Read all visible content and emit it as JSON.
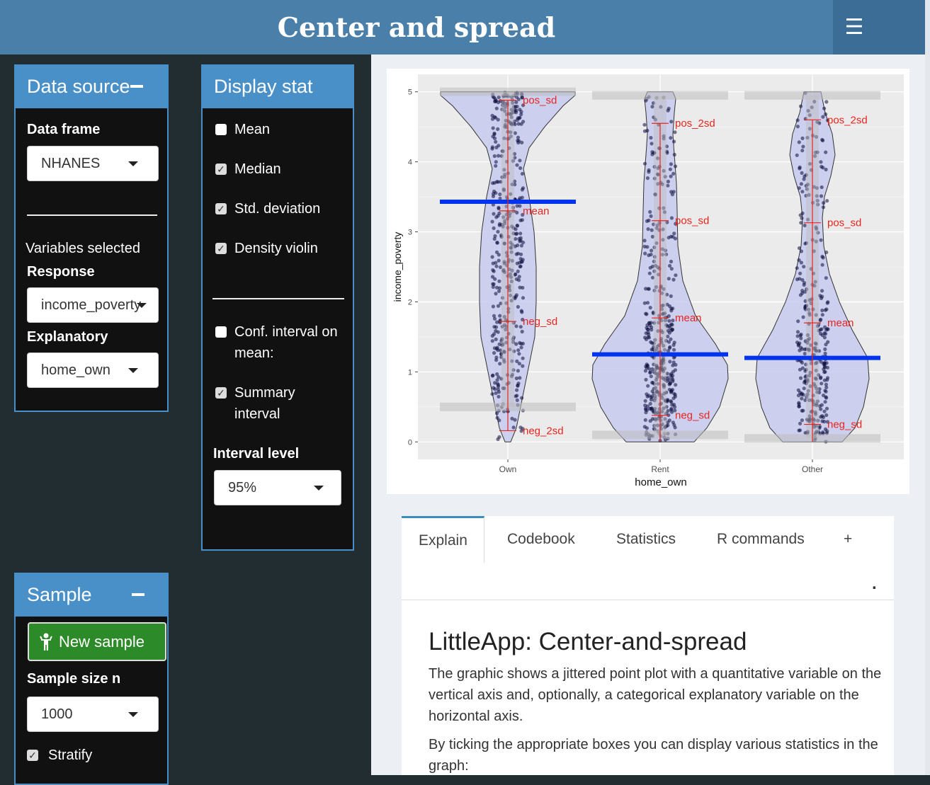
{
  "header": {
    "title": "Center and spread",
    "menu_icon": "hamburger-icon"
  },
  "data_source": {
    "title": "Data source",
    "data_frame_label": "Data frame",
    "data_frame_value": "NHANES",
    "variables_label": "Variables selected",
    "response_label": "Response",
    "response_value": "income_poverty",
    "explanatory_label": "Explanatory",
    "explanatory_value": "home_own"
  },
  "display_stat": {
    "title": "Display stat",
    "options": [
      {
        "label": "Mean",
        "checked": false
      },
      {
        "label": "Median",
        "checked": true
      },
      {
        "label": "Std. deviation",
        "checked": true
      },
      {
        "label": "Density violin",
        "checked": true
      }
    ],
    "conf_interval_line1": "Conf. interval on",
    "conf_interval_line2": "mean:",
    "conf_interval_checked": false,
    "summary_line1": "Summary",
    "summary_line2": "interval",
    "summary_checked": true,
    "interval_level_label": "Interval level",
    "interval_level_value": "95%"
  },
  "sample": {
    "title": "Sample",
    "new_sample_label": "New sample",
    "sample_size_label": "Sample size n",
    "sample_size_value": "1000",
    "stratify_label": "Stratify",
    "stratify_checked": true
  },
  "colors": {
    "header": "#4a7fa9",
    "box_header": "#4a90c8",
    "violin_fill": "#c8caf0",
    "median_line": "#0033ee",
    "stat_red": "#e8251f",
    "button_green": "#2d8a29"
  },
  "chart_data": {
    "type": "violin",
    "xlabel": "home_own",
    "ylabel": "income_poverty",
    "categories": [
      "Own",
      "Rent",
      "Other"
    ],
    "ylim": [
      0,
      5
    ],
    "yticks": [
      0,
      1,
      2,
      3,
      4,
      5
    ],
    "grid": true,
    "groups": [
      {
        "name": "Own",
        "median": 3.43,
        "mean": 3.3,
        "pos_sd": 4.88,
        "neg_sd": 1.72,
        "pos_2sd": 4.88,
        "neg_2sd": 0.16,
        "interval_low": 0.5,
        "interval_high": 5.0,
        "stat_labels": {
          "pos_sd": "pos_sd",
          "mean": "mean",
          "neg_sd": "neg_sd",
          "neg_2sd": "neg_2sd"
        }
      },
      {
        "name": "Rent",
        "median": 1.25,
        "mean": 1.77,
        "pos_sd": 3.16,
        "neg_sd": 0.38,
        "pos_2sd": 4.55,
        "neg_2sd": 0.0,
        "interval_low": 0.1,
        "interval_high": 4.95,
        "stat_labels": {
          "pos_2sd": "pos_2sd",
          "pos_sd": "pos_sd",
          "mean": "mean",
          "neg_sd": "neg_sd"
        }
      },
      {
        "name": "Other",
        "median": 1.2,
        "mean": 1.7,
        "pos_sd": 3.13,
        "neg_sd": 0.25,
        "pos_2sd": 4.6,
        "neg_2sd": 0.0,
        "interval_low": 0.05,
        "interval_high": 4.95,
        "stat_labels": {
          "pos_2sd": "pos_2sd",
          "pos_sd": "pos_sd",
          "mean": "mean",
          "neg_sd": "neg_sd"
        }
      }
    ]
  },
  "tabs": {
    "items": [
      "Explain",
      "Codebook",
      "Statistics",
      "R commands",
      "+"
    ],
    "active": "Explain",
    "dot": "."
  },
  "explain": {
    "heading": "LittleApp: Center-and-spread",
    "paragraph1": "The graphic shows a jittered point plot with a quantitative variable on the vertical axis and, optionally, a categorical explanatory variable on the horizontal axis.",
    "paragraph2": "By ticking the appropriate boxes you can display various statistics in the graph:"
  }
}
